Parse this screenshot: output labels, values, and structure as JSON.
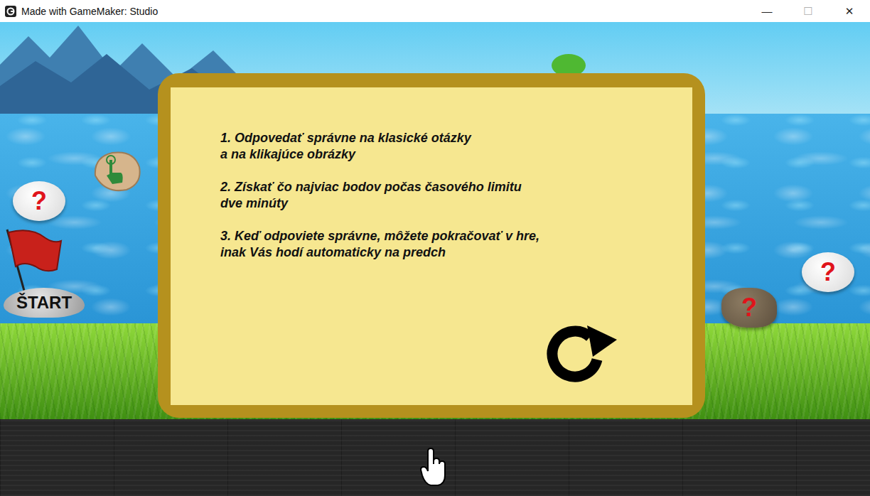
{
  "window": {
    "title": "Made with GameMaker: Studio",
    "controls": [
      "—",
      "☐",
      "✕"
    ]
  },
  "scene": {
    "stones": [
      {
        "label": "?",
        "kind": "white"
      },
      {
        "label": "?",
        "kind": "white"
      },
      {
        "label": "?",
        "kind": "brown"
      }
    ],
    "start": "ŠTART"
  },
  "dialog": {
    "rules": [
      {
        "lines": [
          "1. Odpovedať správne na klasické otázky",
          "a na klikajúce obrázky"
        ]
      },
      {
        "lines": [
          "2. Získať čo najviac bodov počas časového limitu",
          "dve minúty"
        ]
      },
      {
        "lines": [
          "3. Keď odpoviete správne, môžete pokračovať v hre,",
          "inak Vás hodí automaticky na predch"
        ]
      }
    ]
  }
}
